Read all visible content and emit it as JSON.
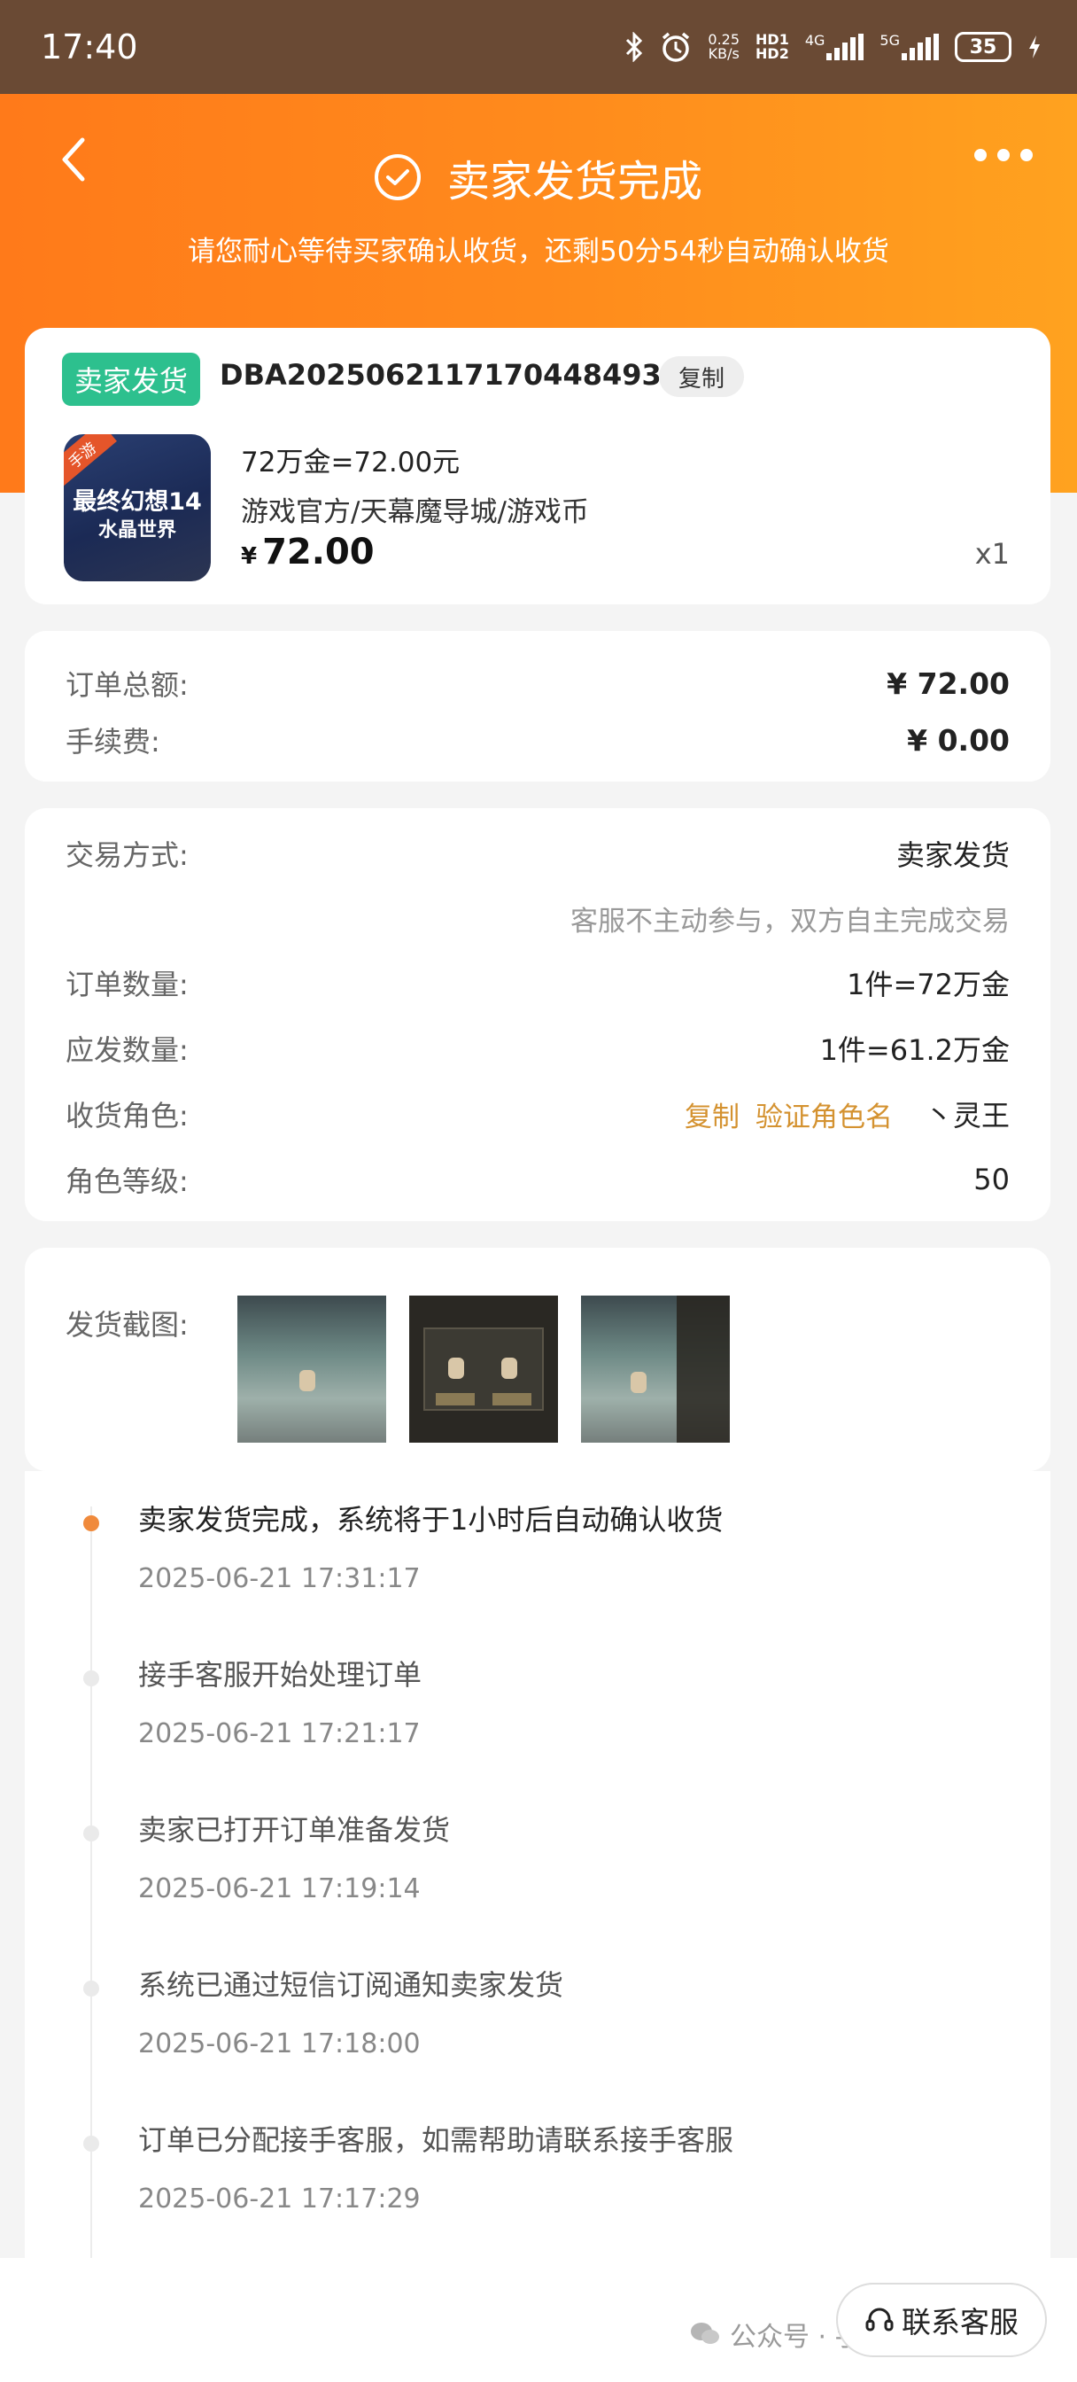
{
  "status_bar": {
    "time": "17:40",
    "net_speed_top": "0.25",
    "net_speed_bottom": "KB/s",
    "hd_top": "HD1",
    "hd_bottom": "HD2",
    "sig1_label": "4G",
    "sig2_label": "5G",
    "battery": "35",
    "icons": [
      "bluetooth-icon",
      "alarm-icon",
      "signal-icon",
      "battery-icon",
      "charging-icon"
    ]
  },
  "header": {
    "title": "卖家发货完成",
    "subtitle": "请您耐心等待买家确认收货，还剩50分54秒自动确认收货",
    "color_from": "#ff7a1a",
    "color_to": "#ffa21f"
  },
  "order": {
    "badge": "卖家发货",
    "badge_color": "#2dc08e",
    "order_no": "DBA2025062117170448493",
    "copy_label": "复制",
    "game_tag": "手游",
    "game_title_1": "最终幻想14",
    "game_title_2": "水晶世界",
    "item_name": "72万金=72.00元",
    "item_path": "游戏官方/天幕魔导城/游戏币",
    "currency": "¥",
    "price": "72.00",
    "quantity": "x1"
  },
  "fees": {
    "total_label": "订单总额:",
    "total_value": "¥ 72.00",
    "fee_label": "手续费:",
    "fee_value": "¥ 0.00"
  },
  "details": {
    "trade_label": "交易方式:",
    "trade_value": "卖家发货",
    "trade_note": "客服不主动参与，双方自主完成交易",
    "order_qty_label": "订单数量:",
    "order_qty_value": "1件=72万金",
    "ship_qty_label": "应发数量:",
    "ship_qty_value": "1件=61.2万金",
    "role_label": "收货角色:",
    "role_copy": "复制",
    "role_verify": "验证角色名",
    "role_value": "丶灵王",
    "level_label": "角色等级:",
    "level_value": "50",
    "accent_color": "#d49230"
  },
  "screenshots": {
    "label": "发货截图:"
  },
  "timeline": [
    {
      "text": "卖家发货完成，系统将于1小时后自动确认收货",
      "time": "2025-06-21 17:31:17"
    },
    {
      "text": "接手客服开始处理订单",
      "time": "2025-06-21 17:21:17"
    },
    {
      "text": "卖家已打开订单准备发货",
      "time": "2025-06-21 17:19:14"
    },
    {
      "text": "系统已通过短信订阅通知卖家发货",
      "time": "2025-06-21 17:18:00"
    },
    {
      "text": "订单已分配接手客服，如需帮助请联系接手客服",
      "time": "2025-06-21 17:17:29"
    }
  ],
  "bottom": {
    "service_label": "联系客服",
    "watermark": "公众号 · 手游搬砖基地"
  }
}
